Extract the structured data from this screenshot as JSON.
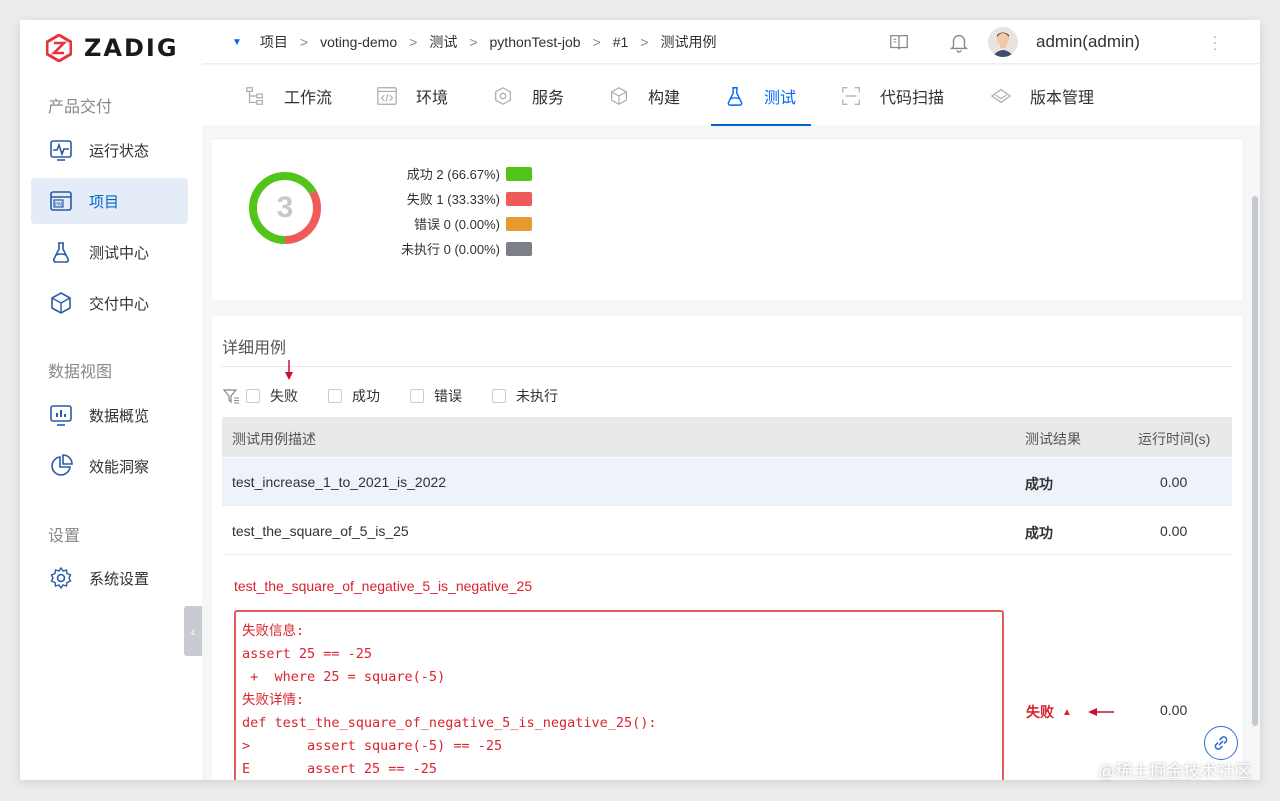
{
  "app": {
    "logo_text": "ZADIG"
  },
  "sidebar": {
    "sections": [
      {
        "title": "产品交付"
      },
      {
        "title": "数据视图"
      },
      {
        "title": "设置"
      }
    ],
    "items": [
      {
        "label": "运行状态",
        "icon": "pulse-monitor-icon"
      },
      {
        "label": "项目",
        "icon": "project-pm-icon",
        "active": true
      },
      {
        "label": "测试中心",
        "icon": "flask-icon"
      },
      {
        "label": "交付中心",
        "icon": "package-cube-icon"
      },
      {
        "label": "数据概览",
        "icon": "bar-chart-monitor-icon"
      },
      {
        "label": "效能洞察",
        "icon": "pie-chart-icon"
      },
      {
        "label": "系统设置",
        "icon": "gear-icon"
      }
    ]
  },
  "header": {
    "breadcrumbs": [
      "项目",
      "voting-demo",
      "测试",
      "pythonTest-job",
      "#1",
      "测试用例"
    ],
    "separator": ">",
    "user": "admin(admin)"
  },
  "tabs": [
    {
      "label": "工作流",
      "icon": "workflow-icon"
    },
    {
      "label": "环境",
      "icon": "environment-code-icon"
    },
    {
      "label": "服务",
      "icon": "service-hexagon-icon"
    },
    {
      "label": "构建",
      "icon": "build-cube-icon"
    },
    {
      "label": "测试",
      "icon": "flask-icon",
      "active": true
    },
    {
      "label": "代码扫描",
      "icon": "scan-icon"
    },
    {
      "label": "版本管理",
      "icon": "version-diamond-icon"
    }
  ],
  "summary": {
    "total": "3",
    "legend": [
      {
        "label": "成功 2 (66.67%)",
        "color": "#52c41a",
        "count": 2
      },
      {
        "label": "失败 1 (33.33%)",
        "color": "#ef5b5b",
        "count": 1
      },
      {
        "label": "错误 0 (0.00%)",
        "color": "#e99a2f",
        "count": 0
      },
      {
        "label": "未执行 0 (0.00%)",
        "color": "#7c7f85",
        "count": 0
      }
    ]
  },
  "detail": {
    "title": "详细用例",
    "filters": [
      "失败",
      "成功",
      "错误",
      "未执行"
    ],
    "columns": [
      "测试用例描述",
      "测试结果",
      "运行时间(s)"
    ],
    "rows": [
      {
        "name": "test_increase_1_to_2021_is_2022",
        "result": "成功",
        "time": "0.00"
      },
      {
        "name": "test_the_square_of_5_is_25",
        "result": "成功",
        "time": "0.00"
      }
    ],
    "failed_case": {
      "name": "test_the_square_of_negative_5_is_negative_25",
      "result": "失败",
      "time": "0.00",
      "output_lines": [
        "失败信息:",
        "assert 25 == -25",
        " +  where 25 = square(-5)",
        "失败详情:",
        "def test_the_square_of_negative_5_is_negative_25():",
        ">       assert square(-5) == -25",
        "E       assert 25 == -25"
      ]
    }
  },
  "watermark": "@稀土掘金技术社区"
}
